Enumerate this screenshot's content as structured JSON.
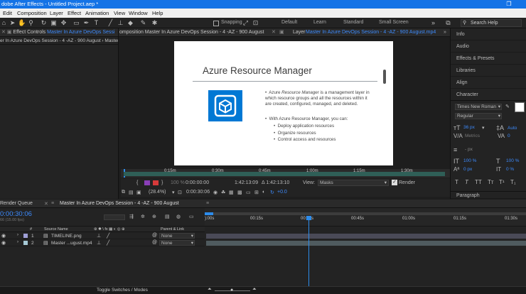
{
  "app": {
    "title": "dobe After Effects - Untitled Project.aep *",
    "window_restore": "❐",
    "window_close": "✕"
  },
  "menu": [
    "Edit",
    "Composition",
    "Layer",
    "Effect",
    "Animation",
    "View",
    "Window",
    "Help"
  ],
  "toolbar": {
    "snapping_label": "Snapping",
    "workspaces": [
      "Default",
      "Learn",
      "Standard",
      "Small Screen"
    ],
    "search_placeholder": "Search Help"
  },
  "panels": {
    "effect_controls_prefix": "Effect Controls",
    "effect_controls_target": "Master In Azure DevOps Sessi",
    "composition_tab": "omposition Master In Azure DevOps Session - 4 -AZ - 900 August",
    "layer_prefix": "Layer",
    "layer_target": "Master In Azure DevOps Session - 4 -AZ - 900 August.mp4",
    "breadcrumb": "er In Azure DevOps Session - 4 -AZ - 900 August › Master I"
  },
  "slide": {
    "title": "Azure Resource Manager",
    "bullet1_pre": "Azure",
    "bullet1_em": "Resource Manager",
    "bullet1_post": "is a management layer in which resource groups and all the resources within it are created, configured, managed, and deleted.",
    "bullet2": "With Azure Resource Manager, you can:",
    "subbullets": [
      "Deploy application resources",
      "Organize resources",
      "Control access and resources"
    ]
  },
  "scrubber": {
    "ticks": [
      "0:15m",
      "0:30m",
      "0:45m",
      "1:00m",
      "1:15m",
      "1:30m"
    ]
  },
  "viewer": {
    "current_time": "0:00:00:00",
    "duration": "1:42:13:09",
    "delta": "Δ 1:42:13:10",
    "view_label": "View:",
    "view_value": "Masks",
    "render_label": "Render",
    "zoom": "(28.4%)",
    "comp_time": "0:00:30:06",
    "offset": "+0.0",
    "percent": "100 %"
  },
  "character": {
    "tabs": [
      "Info",
      "Audio",
      "Effects & Presets",
      "Libraries",
      "Align",
      "Character"
    ],
    "font": "Times New Roman",
    "style": "Regular",
    "size": "36 px",
    "leading": "Auto",
    "kerning": "Metrics",
    "tracking": "0",
    "stroke_width": "- px",
    "vscale": "100 %",
    "hscale": "100 %",
    "baseline": "0 px",
    "tsume": "0 %",
    "paragraph": "Paragraph",
    "style_buttons": [
      "T",
      "T",
      "TT",
      "Tт",
      "T¹",
      "T₁"
    ]
  },
  "timeline": {
    "render_queue_tab": "Render Queue",
    "comp_tab": "Master In Azure DevOps Session - 4 -AZ - 900 August",
    "timecode": "0:00:30:06",
    "fps_note": "66 (15.00 fps)",
    "columns": {
      "num": "#",
      "source": "Source Name",
      "parent": "Parent & Link"
    },
    "layers": [
      {
        "num": "1",
        "name": "TIMELINE.png",
        "parent": "None",
        "color": "#9f9fd6"
      },
      {
        "num": "2",
        "name": "Master ...ugust.mp4",
        "parent": "None",
        "color": "#a6c9d6"
      }
    ],
    "ruler": [
      "):00s",
      "00:15s",
      "00:30s",
      "00:45s",
      "01:00s",
      "01:15s",
      "01:30s"
    ],
    "toggle_label": "Toggle Switches / Modes"
  },
  "colors": {
    "accent": "#1473e6",
    "playhead": "#2d8ceb",
    "azure_icon": "#0078d4"
  }
}
